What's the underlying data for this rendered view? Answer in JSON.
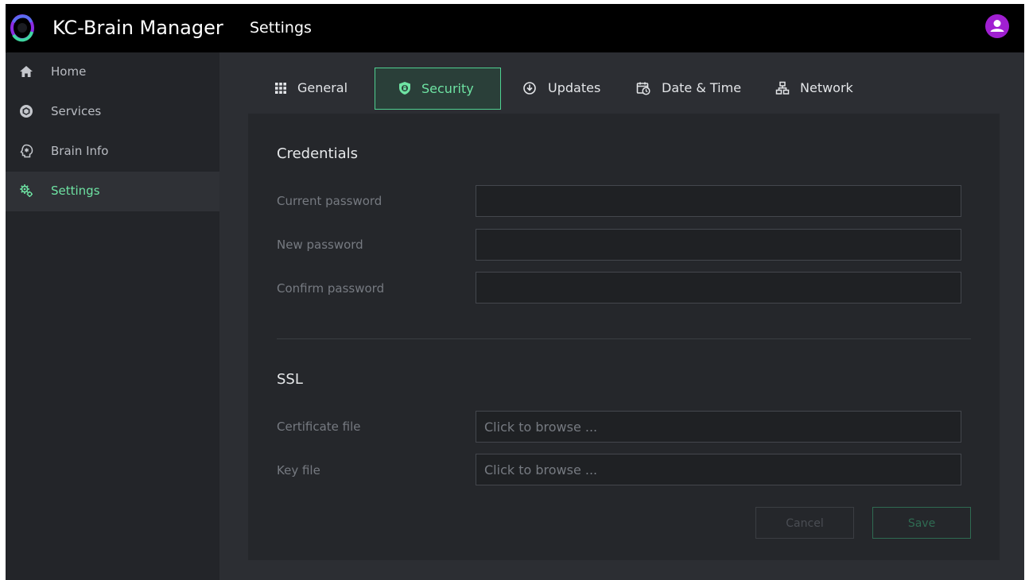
{
  "header": {
    "app_title": "KC-Brain Manager",
    "page_title": "Settings",
    "logo_icon": "kc-brain-logo",
    "avatar_icon": "user-icon",
    "colors": {
      "background": "#000000",
      "avatar": "#a01fd1"
    }
  },
  "sidebar": {
    "items": [
      {
        "label": "Home",
        "icon": "home-icon",
        "active": false
      },
      {
        "label": "Services",
        "icon": "cube-icon",
        "active": false
      },
      {
        "label": "Brain Info",
        "icon": "brain-icon",
        "active": false
      },
      {
        "label": "Settings",
        "icon": "gears-icon",
        "active": true
      }
    ]
  },
  "tabs": [
    {
      "label": "General",
      "icon": "grid-icon",
      "active": false
    },
    {
      "label": "Security",
      "icon": "shield-lock-icon",
      "active": true
    },
    {
      "label": "Updates",
      "icon": "download-circle-icon",
      "active": false
    },
    {
      "label": "Date & Time",
      "icon": "calendar-clock-icon",
      "active": false
    },
    {
      "label": "Network",
      "icon": "network-icon",
      "active": false
    }
  ],
  "credentials": {
    "title": "Credentials",
    "current_password": {
      "label": "Current password",
      "value": ""
    },
    "new_password": {
      "label": "New password",
      "value": ""
    },
    "confirm_password": {
      "label": "Confirm password",
      "value": ""
    }
  },
  "ssl": {
    "title": "SSL",
    "certificate_file": {
      "label": "Certificate file",
      "placeholder": "Click to browse ..."
    },
    "key_file": {
      "label": "Key file",
      "placeholder": "Click to browse ..."
    }
  },
  "actions": {
    "cancel_label": "Cancel",
    "save_label": "Save"
  },
  "colors": {
    "accent": "#6ee3a3",
    "accent_border": "#4fd191",
    "app_background": "#2c2e33",
    "sidebar_background": "#232529",
    "panel_background": "#25272b"
  }
}
